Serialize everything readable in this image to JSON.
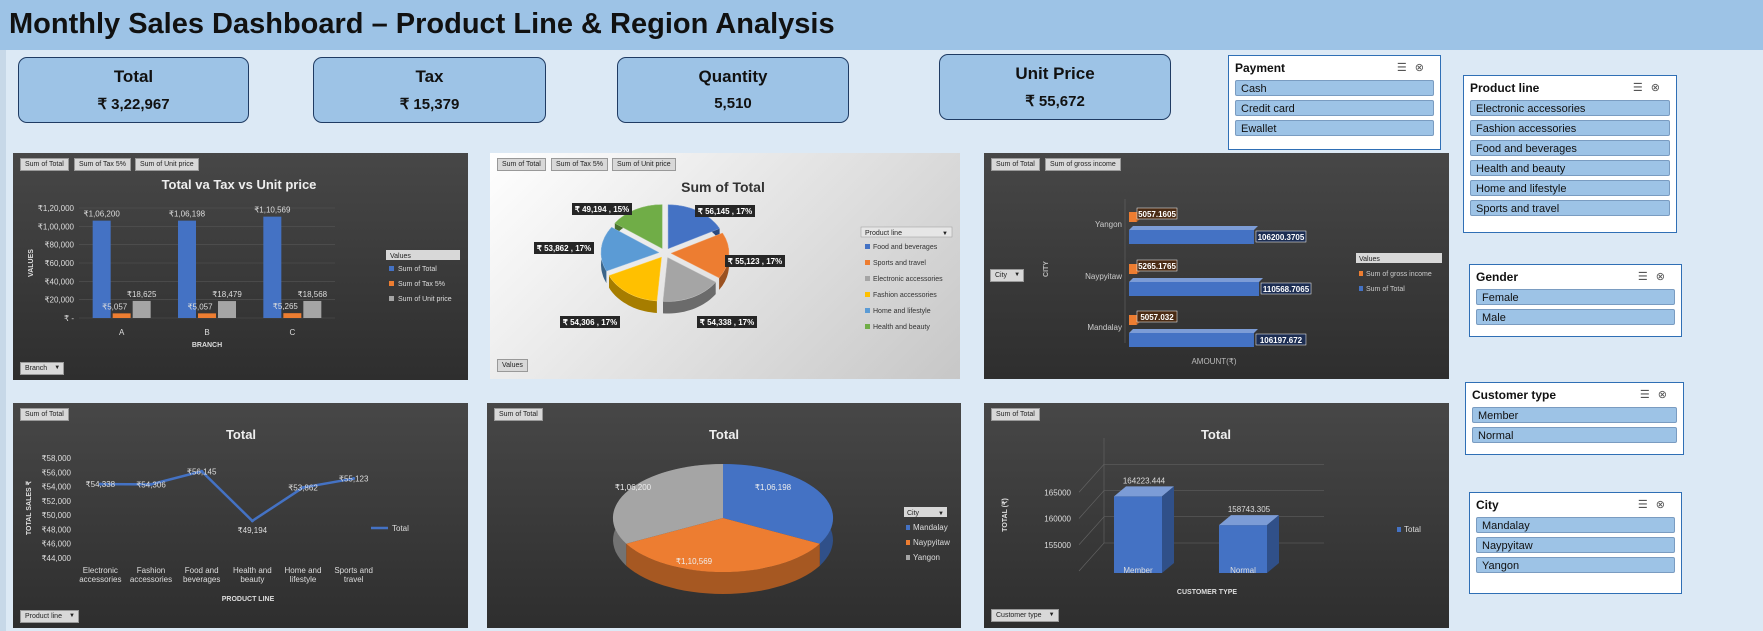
{
  "title": "Monthly Sales Dashboard – Product Line & Region Analysis",
  "kpis": [
    {
      "label": "Total",
      "value": "₹ 3,22,967"
    },
    {
      "label": "Tax",
      "value": "₹ 15,379"
    },
    {
      "label": "Quantity",
      "value": "5,510"
    },
    {
      "label": "Unit Price",
      "value": "₹ 55,672"
    }
  ],
  "slicers": {
    "payment": {
      "title": "Payment",
      "items": [
        "Cash",
        "Credit card",
        "Ewallet"
      ]
    },
    "product_line": {
      "title": "Product line",
      "items": [
        "Electronic accessories",
        "Fashion accessories",
        "Food and beverages",
        "Health and beauty",
        "Home and lifestyle",
        "Sports and travel"
      ]
    },
    "gender": {
      "title": "Gender",
      "items": [
        "Female",
        "Male"
      ]
    },
    "customer_type": {
      "title": "Customer type",
      "items": [
        "Member",
        "Normal"
      ]
    },
    "city": {
      "title": "City",
      "items": [
        "Mandalay",
        "Naypyitaw",
        "Yangon"
      ]
    }
  },
  "icons": {
    "multi_select": "multi-select-icon",
    "clear_filter": "clear-filter-icon"
  },
  "colors": {
    "blue": "#4472c4",
    "orange": "#ed7d31",
    "gray": "#a5a5a5",
    "yellow": "#ffc000",
    "lightblue": "#5b9bd5",
    "green": "#70ad47"
  },
  "chart_data": [
    {
      "type": "bar",
      "title": "Total va Tax vs Unit price",
      "field_buttons": [
        "Sum of Total",
        "Sum of Tax 5%",
        "Sum of Unit price"
      ],
      "axis_button": "Branch",
      "xlabel": "BRANCH",
      "ylabel": "VALUES",
      "categories": [
        "A",
        "B",
        "C"
      ],
      "yticks": [
        "₹1,20,000",
        "₹1,00,000",
        "₹80,000",
        "₹60,000",
        "₹40,000",
        "₹20,000",
        "₹ -"
      ],
      "ylim": [
        0,
        120000
      ],
      "legend_title": "Values",
      "legend_position": "right",
      "series": [
        {
          "name": "Sum of Total",
          "values": [
            106200,
            106198,
            110569
          ],
          "labels": [
            "₹1,06,200",
            "₹1,06,198",
            "₹1,10,569"
          ]
        },
        {
          "name": "Sum of Tax 5%",
          "values": [
            5057,
            5057,
            5265
          ],
          "labels": [
            "₹5,057",
            "₹5,057",
            "₹5,265"
          ]
        },
        {
          "name": "Sum of Unit price",
          "values": [
            18625,
            18479,
            18568
          ],
          "labels": [
            "₹18,625",
            "₹18,479",
            "₹18,568"
          ]
        }
      ]
    },
    {
      "type": "pie",
      "title": "Sum of Total",
      "field_buttons": [
        "Sum of Total",
        "Sum of Tax 5%",
        "Sum of Unit price"
      ],
      "values_button": "Values",
      "legend_title": "Product line",
      "legend_position": "right",
      "categories": [
        "Food and beverages",
        "Sports and travel",
        "Electronic accessories",
        "Fashion accessories",
        "Home and lifestyle",
        "Health and beauty"
      ],
      "values": [
        56145,
        55123,
        54338,
        54306,
        53862,
        49194
      ],
      "labels": [
        "₹ 56,145 , 17%",
        "₹ 55,123 , 17%",
        "₹ 54,338 , 17%",
        "₹ 54,306 , 17%",
        "₹ 53,862 , 17%",
        "₹ 49,194 , 15%"
      ]
    },
    {
      "type": "bar",
      "orientation": "horizontal",
      "field_buttons": [
        "Sum of Total",
        "Sum of gross income"
      ],
      "axis_button": "City",
      "xlabel": "AMOUNT(₹)",
      "ylabel": "CITY",
      "categories": [
        "Yangon",
        "Naypyitaw",
        "Mandalay"
      ],
      "legend_title": "Values",
      "legend_position": "right",
      "series": [
        {
          "name": "Sum of gross income",
          "values": [
            5057.1605,
            5265.1765,
            5057.032
          ],
          "labels": [
            "5057.1605",
            "5265.1765",
            "5057.032"
          ]
        },
        {
          "name": "Sum of Total",
          "values": [
            106200.3705,
            110568.7065,
            106197.672
          ],
          "labels": [
            "106200.3705",
            "110568.7065",
            "106197.672"
          ]
        }
      ]
    },
    {
      "type": "line",
      "title": "Total",
      "field_buttons": [
        "Sum of Total"
      ],
      "axis_button": "Product line",
      "xlabel": "PRODUCT LINE",
      "ylabel": "TOTAL SALES ₹",
      "categories": [
        "Electronic accessories",
        "Fashion accessories",
        "Food and beverages",
        "Health and beauty",
        "Home and lifestyle",
        "Sports and travel"
      ],
      "yticks": [
        "₹58,000",
        "₹56,000",
        "₹54,000",
        "₹52,000",
        "₹50,000",
        "₹48,000",
        "₹46,000",
        "₹44,000"
      ],
      "ylim": [
        44000,
        58000
      ],
      "legend_position": "right",
      "series": [
        {
          "name": "Total",
          "values": [
            54338,
            54306,
            56145,
            49194,
            53862,
            55123
          ],
          "labels": [
            "₹54,338",
            "₹54,306",
            "₹56,145",
            "₹49,194",
            "₹53,862",
            "₹55,123"
          ]
        }
      ]
    },
    {
      "type": "pie",
      "title": "Total",
      "field_buttons": [
        "Sum of Total"
      ],
      "legend_title": "City",
      "legend_position": "right",
      "categories": [
        "Mandalay",
        "Naypyitaw",
        "Yangon"
      ],
      "values": [
        106198,
        110569,
        106200
      ],
      "labels": [
        "₹1,06,198",
        "₹1,10,569",
        "₹1,06,200"
      ]
    },
    {
      "type": "bar",
      "title": "Total",
      "field_buttons": [
        "Sum of Total"
      ],
      "axis_button": "Customer type",
      "xlabel": "CUSTOMER TYPE",
      "ylabel": "TOTAL (₹)",
      "categories": [
        "Member",
        "Normal"
      ],
      "yticks": [
        "165000",
        "160000",
        "155000"
      ],
      "ylim": [
        150000,
        170000
      ],
      "legend_position": "right",
      "series": [
        {
          "name": "Total",
          "values": [
            164223.444,
            158743.305
          ],
          "labels": [
            "164223.444",
            "158743.305"
          ]
        }
      ]
    }
  ]
}
